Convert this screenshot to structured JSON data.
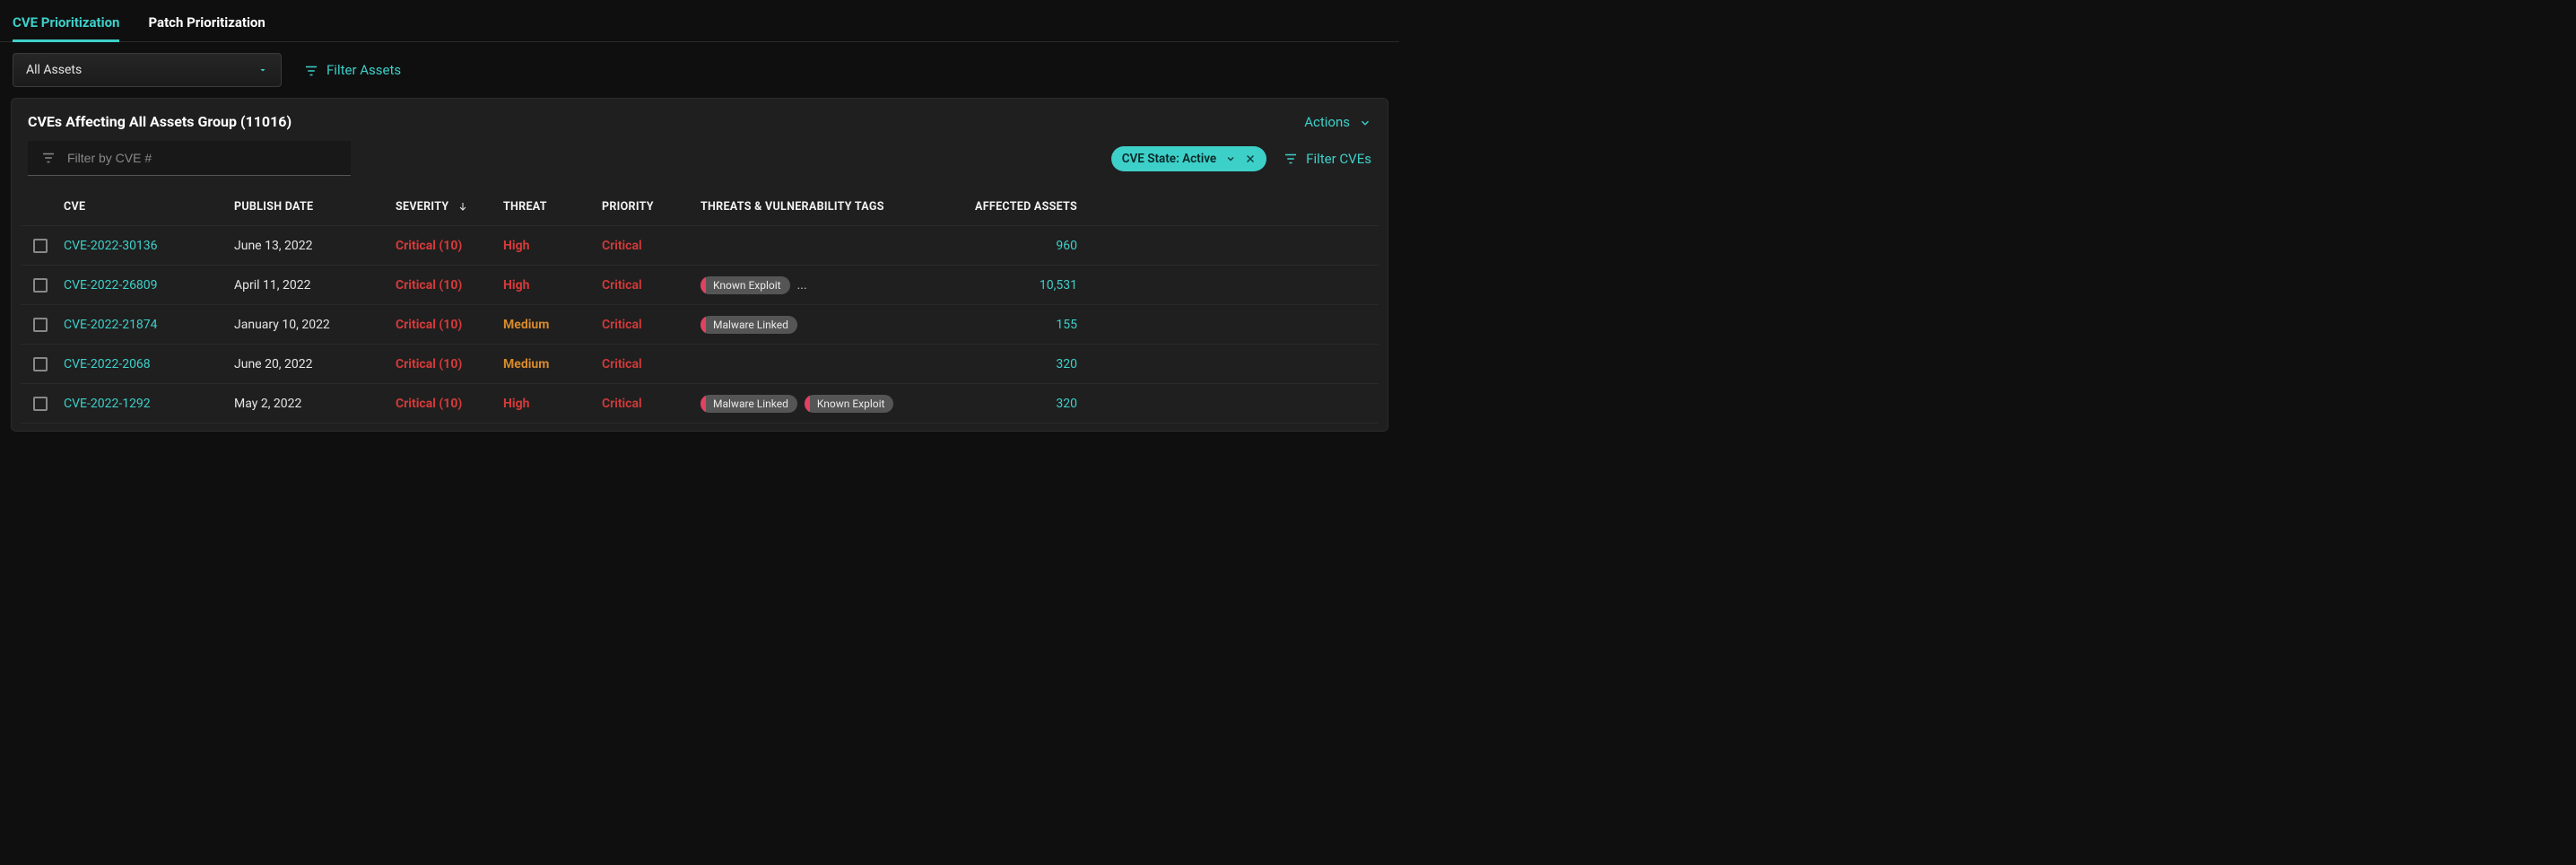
{
  "tabs": {
    "cve": "CVE Prioritization",
    "patch": "Patch Prioritization"
  },
  "asset_select": {
    "value": "All Assets"
  },
  "filter_assets_label": "Filter Assets",
  "panel": {
    "title": "CVEs Affecting All Assets Group (11016)",
    "actions_label": "Actions",
    "search_placeholder": "Filter by CVE #",
    "cve_state_pill": "CVE State: Active",
    "filter_cves_label": "Filter CVEs"
  },
  "columns": {
    "cve": "CVE",
    "publish_date": "PUBLISH DATE",
    "severity": "SEVERITY",
    "threat": "THREAT",
    "priority": "PRIORITY",
    "tags": "THREATS & VULNERABILITY TAGS",
    "affected": "AFFECTED ASSETS"
  },
  "rows": [
    {
      "cve": "CVE-2022-30136",
      "publish_date": "June 13, 2022",
      "severity": "Critical (10)",
      "threat": "High",
      "priority": "Critical",
      "tags": [],
      "tags_overflow": false,
      "affected": "960"
    },
    {
      "cve": "CVE-2022-26809",
      "publish_date": "April 11, 2022",
      "severity": "Critical (10)",
      "threat": "High",
      "priority": "Critical",
      "tags": [
        "Known Exploit"
      ],
      "tags_overflow": true,
      "affected": "10,531"
    },
    {
      "cve": "CVE-2022-21874",
      "publish_date": "January 10, 2022",
      "severity": "Critical (10)",
      "threat": "Medium",
      "priority": "Critical",
      "tags": [
        "Malware Linked"
      ],
      "tags_overflow": false,
      "affected": "155"
    },
    {
      "cve": "CVE-2022-2068",
      "publish_date": "June 20, 2022",
      "severity": "Critical (10)",
      "threat": "Medium",
      "priority": "Critical",
      "tags": [],
      "tags_overflow": false,
      "affected": "320"
    },
    {
      "cve": "CVE-2022-1292",
      "publish_date": "May 2, 2022",
      "severity": "Critical (10)",
      "threat": "High",
      "priority": "Critical",
      "tags": [
        "Malware Linked",
        "Known Exploit"
      ],
      "tags_overflow": false,
      "affected": "320"
    }
  ]
}
